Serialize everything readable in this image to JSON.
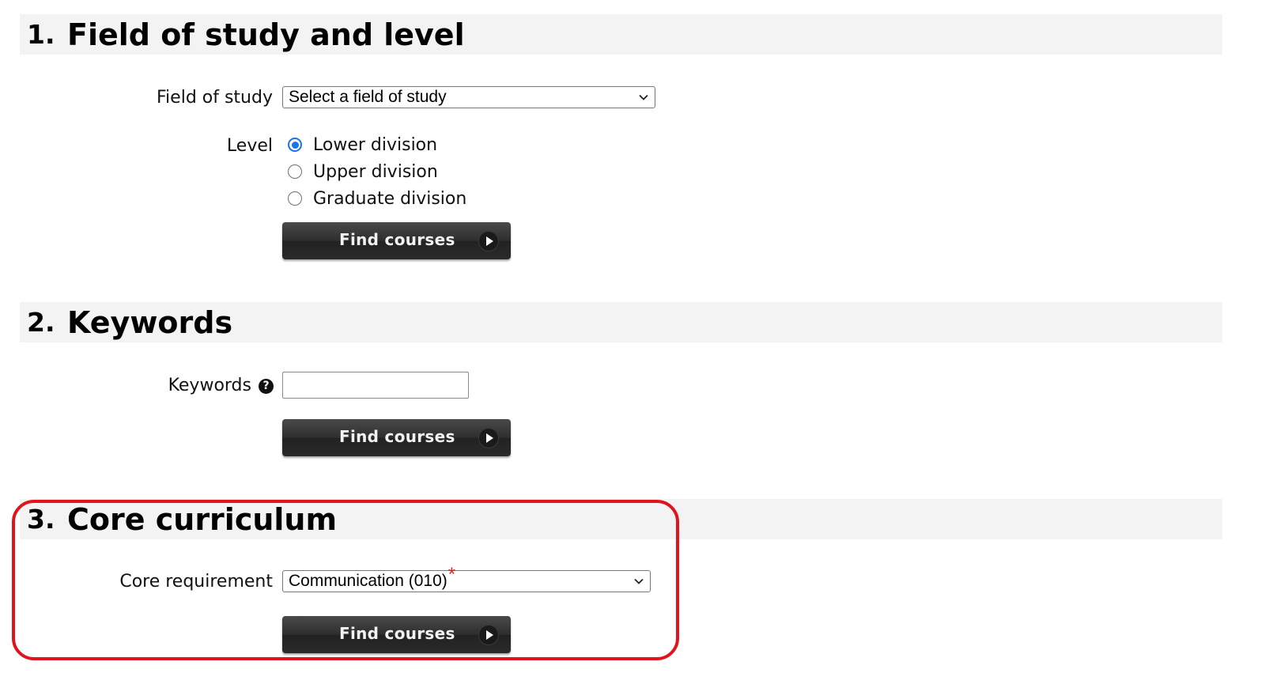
{
  "sections": [
    {
      "number": "1.",
      "title": "Field of study and level"
    },
    {
      "number": "2.",
      "title": "Keywords"
    },
    {
      "number": "3.",
      "title": "Core curriculum"
    }
  ],
  "field_of_study": {
    "label": "Field of study",
    "selected": "Select a field of study"
  },
  "level": {
    "label": "Level",
    "options": [
      "Lower division",
      "Upper division",
      "Graduate division"
    ],
    "selected_index": 0
  },
  "keywords": {
    "label": "Keywords",
    "help_glyph": "?",
    "value": ""
  },
  "core": {
    "label": "Core requirement",
    "selected": "Communication (010)",
    "required_marker": "*"
  },
  "buttons": {
    "find_courses": "Find courses"
  },
  "colors": {
    "header_bg": "#f3f3f3",
    "button_bg": "#2e2e2e",
    "radio_accent": "#1a73e8",
    "highlight": "#e0141b"
  }
}
